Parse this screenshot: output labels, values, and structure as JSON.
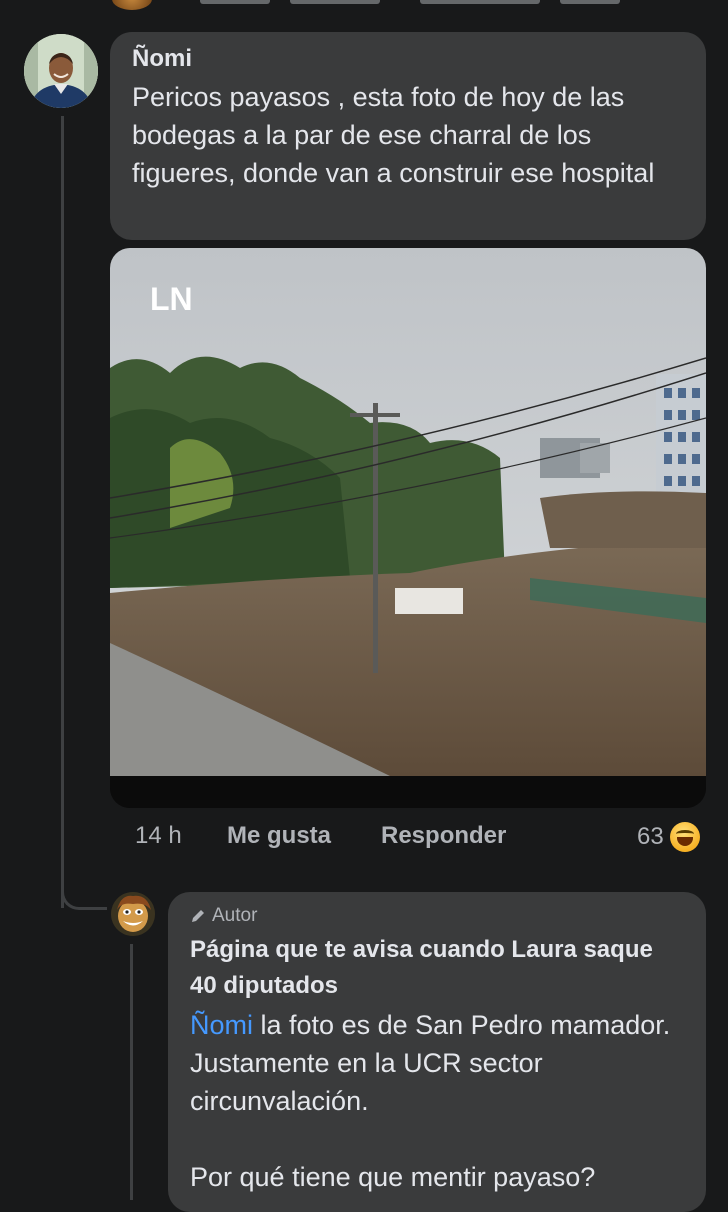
{
  "thread": {
    "comment": {
      "author": "Ñomi",
      "text": "Pericos payasos , esta foto de hoy de las bodegas a la par de ese charral de los figueres, donde van a construir ese hospital",
      "photo_watermark": "LN",
      "time": "14 h",
      "like_label": "Me gusta",
      "reply_label": "Responder",
      "reaction_count": "63",
      "reaction_icon": "laughing-face-icon"
    },
    "reply": {
      "badge_label": "Autor",
      "author": "Página que te avisa cuando Laura saque 40 diputados",
      "mention": "Ñomi",
      "text_after_mention": " la foto es de San Pedro mamador. Justamente en la UCR sector circunvalación.",
      "text_second_paragraph": "Por qué tiene que mentir payaso?"
    }
  },
  "colors": {
    "background": "#18191a",
    "bubble": "#3a3b3c",
    "text": "#e4e6eb",
    "muted": "#b0b3b8",
    "mention": "#4599ff",
    "thread_line": "#3e4042"
  }
}
